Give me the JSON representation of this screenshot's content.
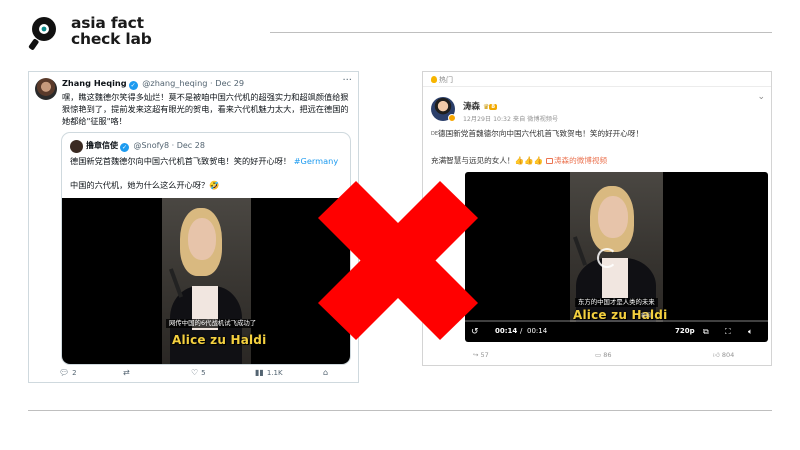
{
  "brand": {
    "line1": "asia fact",
    "line2": "check lab"
  },
  "tweet": {
    "author_name": "Zhang Heqing",
    "handle_date": "@zhang_heqing · Dec 29",
    "more_icon": "more-dots-icon",
    "text": "嘿，瞧这魏德尔笑得多灿烂！莫不是被咱中国六代机的超强实力和超飒颜值给狠狠惊艳到了，提前发来这超有眼光的贺电，看来六代机魅力太大，把远在德国的她都给\"征服\"咯！",
    "quote": {
      "author_name": "撸章信使",
      "handle_date": "@Snofy8 · Dec 28",
      "text_main": "德国新党首魏德尔向中国六代机首飞致贺电！笑的好开心呀！",
      "hashtag": "#Germany",
      "text_line2": "中国的六代机，她为什么这么开心呀？🤣",
      "subtitle_small": "网传中国的6代战机试飞成功了",
      "subtitle_big": "Alice zu Haldi"
    },
    "actions": {
      "replies": "2",
      "retweets": "",
      "likes": "5",
      "views": "1.1K"
    }
  },
  "weibo": {
    "hot_label": "热门",
    "author_name": "涛森",
    "level": "8",
    "meta": "12月29日 10:32 来自 微博视频号",
    "text_prefix": "DE",
    "text_main": "德国新党首魏德尔向中国六代机首飞致贺电！笑的好开心呀！",
    "text_line2": "充满智慧与远见的女人！👍👍👍",
    "link_text": "涛森的微博视频",
    "video": {
      "subtitle_small": "东方的中国才是人类的未来",
      "subtitle_big": "Alice zu Haldi",
      "time_current": "00:14",
      "time_sep": "/",
      "time_total": "00:14",
      "quality": "720p",
      "watermark": "新闻"
    },
    "actions": {
      "reposts": "57",
      "comments": "86",
      "likes": "804"
    }
  },
  "colors": {
    "x_mark": "#ff0000",
    "twitter_blue": "#1d9bf0",
    "weibo_orange": "#eb7350",
    "subtitle_yellow": "#f4d03f"
  }
}
